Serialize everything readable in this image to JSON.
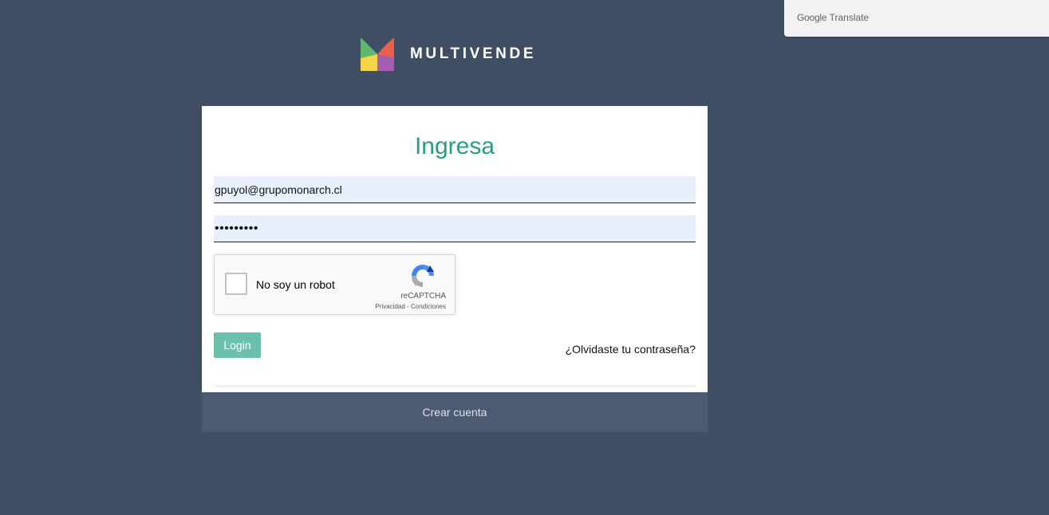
{
  "google_translate": {
    "brand": "Google",
    "product": "Translate"
  },
  "logo": {
    "text": "MULTIVENDE",
    "colors": [
      "#5cb85c",
      "#ee5a4f",
      "#f5d547",
      "#9b59b6"
    ]
  },
  "login_form": {
    "title": "Ingresa",
    "email_value": "gpuyol@grupomonarch.cl",
    "password_value": "•••••••••",
    "login_label": "Login",
    "forgot_label": "¿Olvidaste tu contraseña?"
  },
  "recaptcha": {
    "label": "No soy un robot",
    "brand": "reCAPTCHA",
    "privacy": "Privacidad",
    "separator": "-",
    "terms": "Condiciones"
  },
  "footer": {
    "create_account_label": "Crear cuenta"
  },
  "colors": {
    "background": "#404e64",
    "accent": "#26a083",
    "button": "#6cc0ae",
    "footer_bar": "#4c5a73"
  }
}
